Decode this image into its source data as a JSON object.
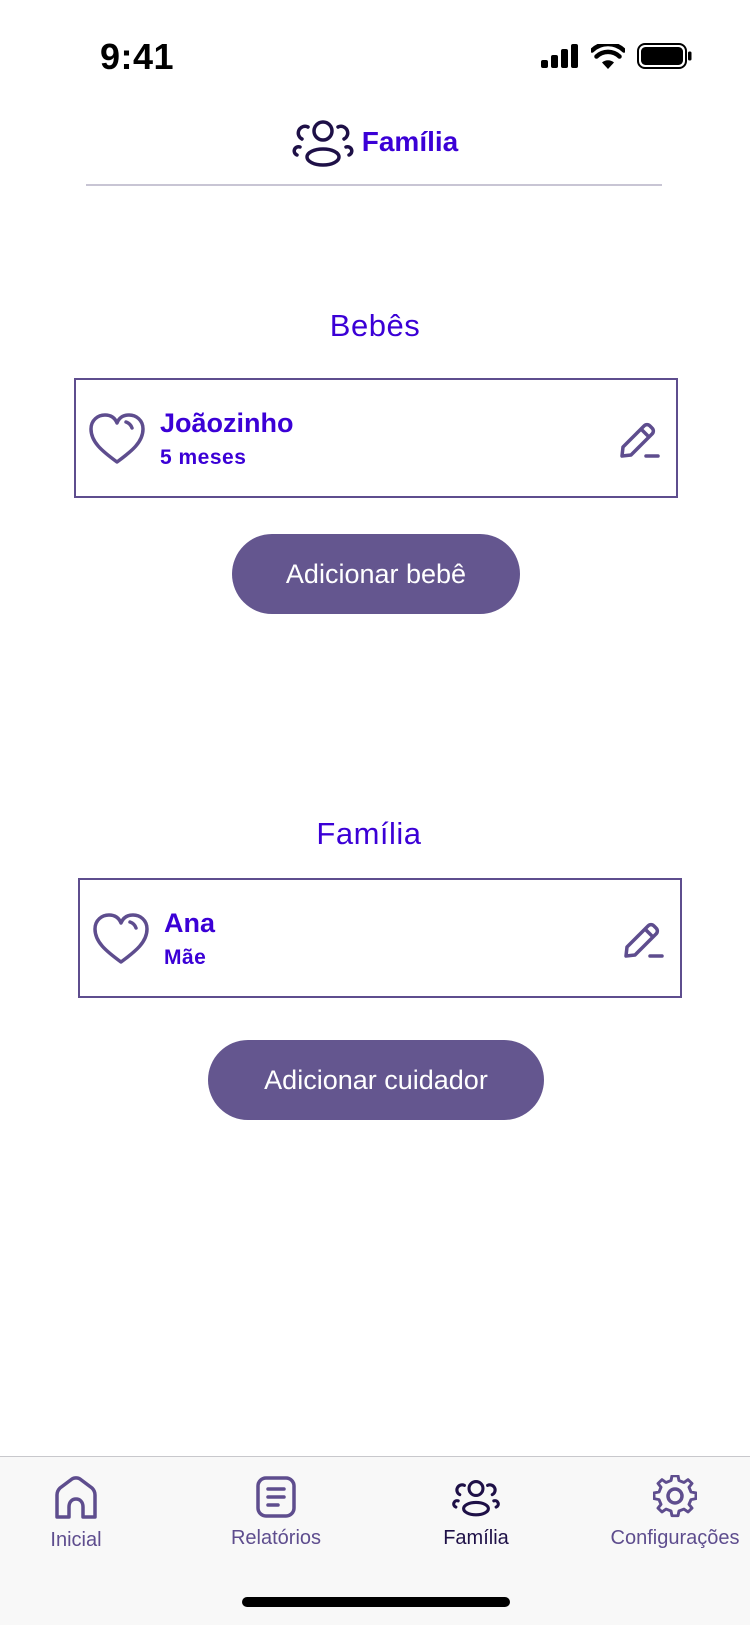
{
  "status_bar": {
    "time": "9:41"
  },
  "header": {
    "icon": "family-icon",
    "title": "Família"
  },
  "babies_section": {
    "title": "Bebês",
    "items": [
      {
        "name": "Joãozinho",
        "detail": "5 meses",
        "icon": "heart-icon",
        "action_icon": "edit-icon"
      }
    ],
    "add_button_label": "Adicionar bebê"
  },
  "family_section": {
    "title": "Família",
    "items": [
      {
        "name": "Ana",
        "detail": "Mãe",
        "icon": "heart-icon",
        "action_icon": "edit-icon"
      }
    ],
    "add_button_label": "Adicionar cuidador"
  },
  "tab_bar": {
    "tabs": [
      {
        "label": "Inicial",
        "icon": "home-icon",
        "active": false
      },
      {
        "label": "Relatórios",
        "icon": "report-icon",
        "active": false
      },
      {
        "label": "Família",
        "icon": "family-icon",
        "active": true
      },
      {
        "label": "Configurações",
        "icon": "gear-icon",
        "active": false
      }
    ]
  },
  "colors": {
    "accent_text": "#3b00d6",
    "button_bg": "#64568f",
    "icon_stroke": "#5e4d8e",
    "active_tab": "#1e1047"
  }
}
